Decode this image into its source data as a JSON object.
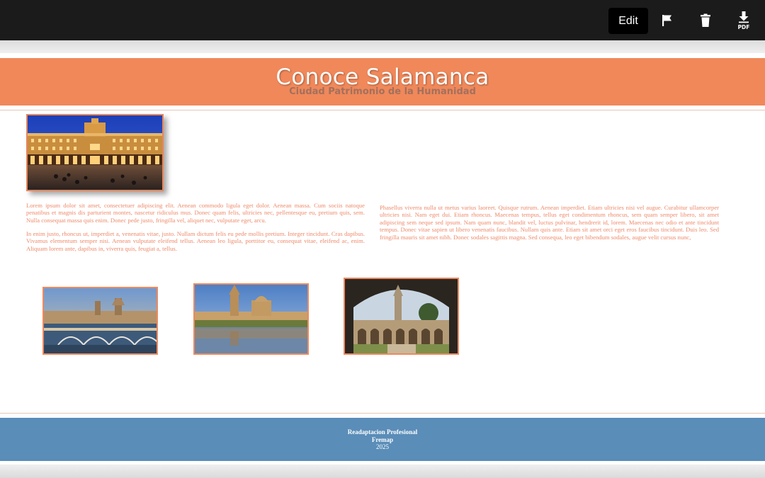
{
  "toolbar": {
    "edit_label": "Edit",
    "icons": [
      "flag-icon",
      "trash-icon",
      "download-pdf-icon"
    ],
    "pdf_label": "PDF"
  },
  "header": {
    "title": "Conoce Salamanca",
    "subtitle": "Ciudad Patrimonio de la Humanidad"
  },
  "content": {
    "left_paragraphs": [
      "Lorem ipsum dolor sit amet, consectetuer adipiscing elit. Aenean commodo ligula eget dolor. Aenean massa. Cum sociis natoque penatibus et magnis dis parturient montes, nascetur ridiculus mus. Donec quam felis, ultricies nec, pellentesque eu, pretium quis, sem. Nulla consequat massa quis enim. Donec pede justo, fringilla vel, aliquet nec, vulputate eget, arcu.",
      "In enim justo, rhoncus ut, imperdiet a, venenatis vitae, justo. Nullam dictum felis eu pede mollis pretium. Integer tincidunt. Cras dapibus. Vivamus elementum semper nisi. Aenean vulputate eleifend tellus. Aenean leo ligula, porttitor eu, consequat vitae, eleifend ac, enim. Aliquam lorem ante, dapibus in, viverra quis, feugiat a, tellus."
    ],
    "right_paragraph": "Phasellus viverra nulla ut metus varius laoreet. Quisque rutrum. Aenean imperdiet. Etiam ultricies nisi vel augue. Curabitur ullamcorper ultricies nisi. Nam eget dui. Etiam rhoncus. Maecenas tempus, tellus eget condimentum rhoncus, sem quam semper libero, sit amet adipiscing sem neque sed ipsum. Nam quam nunc, blandit vel, luctus pulvinar, hendrerit id, lorem. Maecenas nec odio et ante tincidunt tempus. Donec vitae sapien ut libero venenatis faucibus. Nullam quis ante. Etiam sit amet orci eget eros faucibus tincidunt. Duis leo. Sed fringilla mauris sit amet nibh. Donec sodales sagittis magna. Sed consequa, leo eget bibendum sodales, augue velit cursus nunc,"
  },
  "footer": {
    "line1": "Readaptacion Profesional",
    "line2": "Fremap",
    "line3": "2025"
  },
  "colors": {
    "toolbar_bg": "#1b1b1b",
    "header_bg": "#f0885a",
    "footer_bg": "#5a8db8",
    "text_color": "#ee8a6a"
  }
}
